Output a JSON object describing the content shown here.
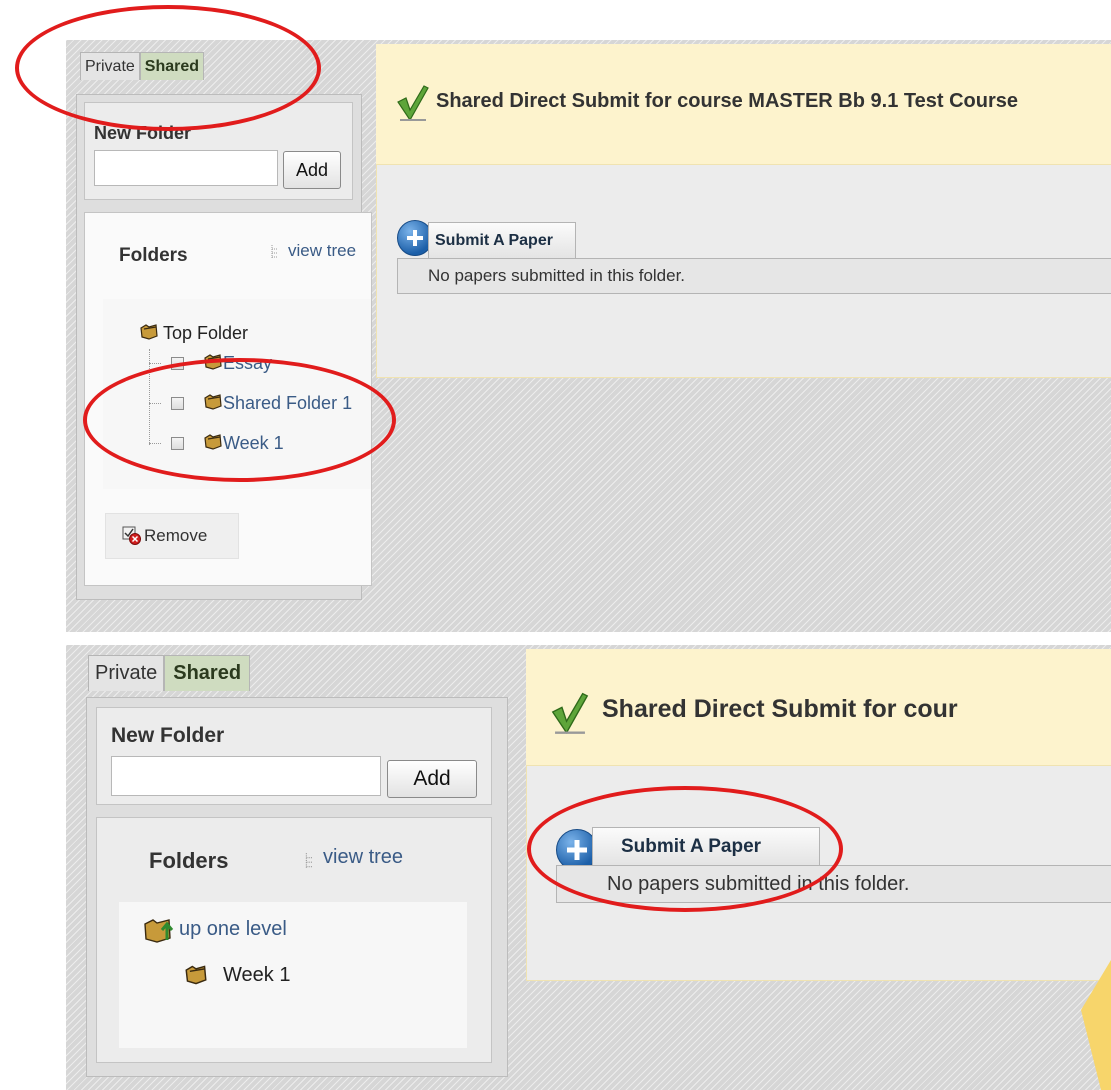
{
  "top": {
    "tabs": {
      "private": "Private",
      "shared": "Shared"
    },
    "new_folder": {
      "label": "New Folder",
      "input_value": "",
      "add_label": "Add"
    },
    "folders": {
      "heading": "Folders",
      "view_tree": "view tree",
      "top_folder": "Top Folder",
      "items": [
        "Essay",
        "Shared Folder 1",
        "Week 1"
      ]
    },
    "remove_label": "Remove",
    "title": "Shared Direct Submit for course MASTER Bb 9.1 Test Course",
    "submit_label": "Submit A Paper",
    "status": "No papers submitted in this folder."
  },
  "bottom": {
    "tabs": {
      "private": "Private",
      "shared": "Shared"
    },
    "new_folder": {
      "label": "New Folder",
      "input_value": "",
      "add_label": "Add"
    },
    "folders": {
      "heading": "Folders",
      "view_tree": "view tree",
      "up_one_level": "up one level",
      "current_folder": "Week 1"
    },
    "title": "Shared Direct Submit for cour",
    "submit_label": "Submit A Paper",
    "status": "No papers submitted in this folder."
  },
  "colors": {
    "annotation": "#e11c1c",
    "header_yellow": "#fdf3cd",
    "link_blue": "#3a5b86",
    "shared_tab": "#cfdcc0"
  }
}
